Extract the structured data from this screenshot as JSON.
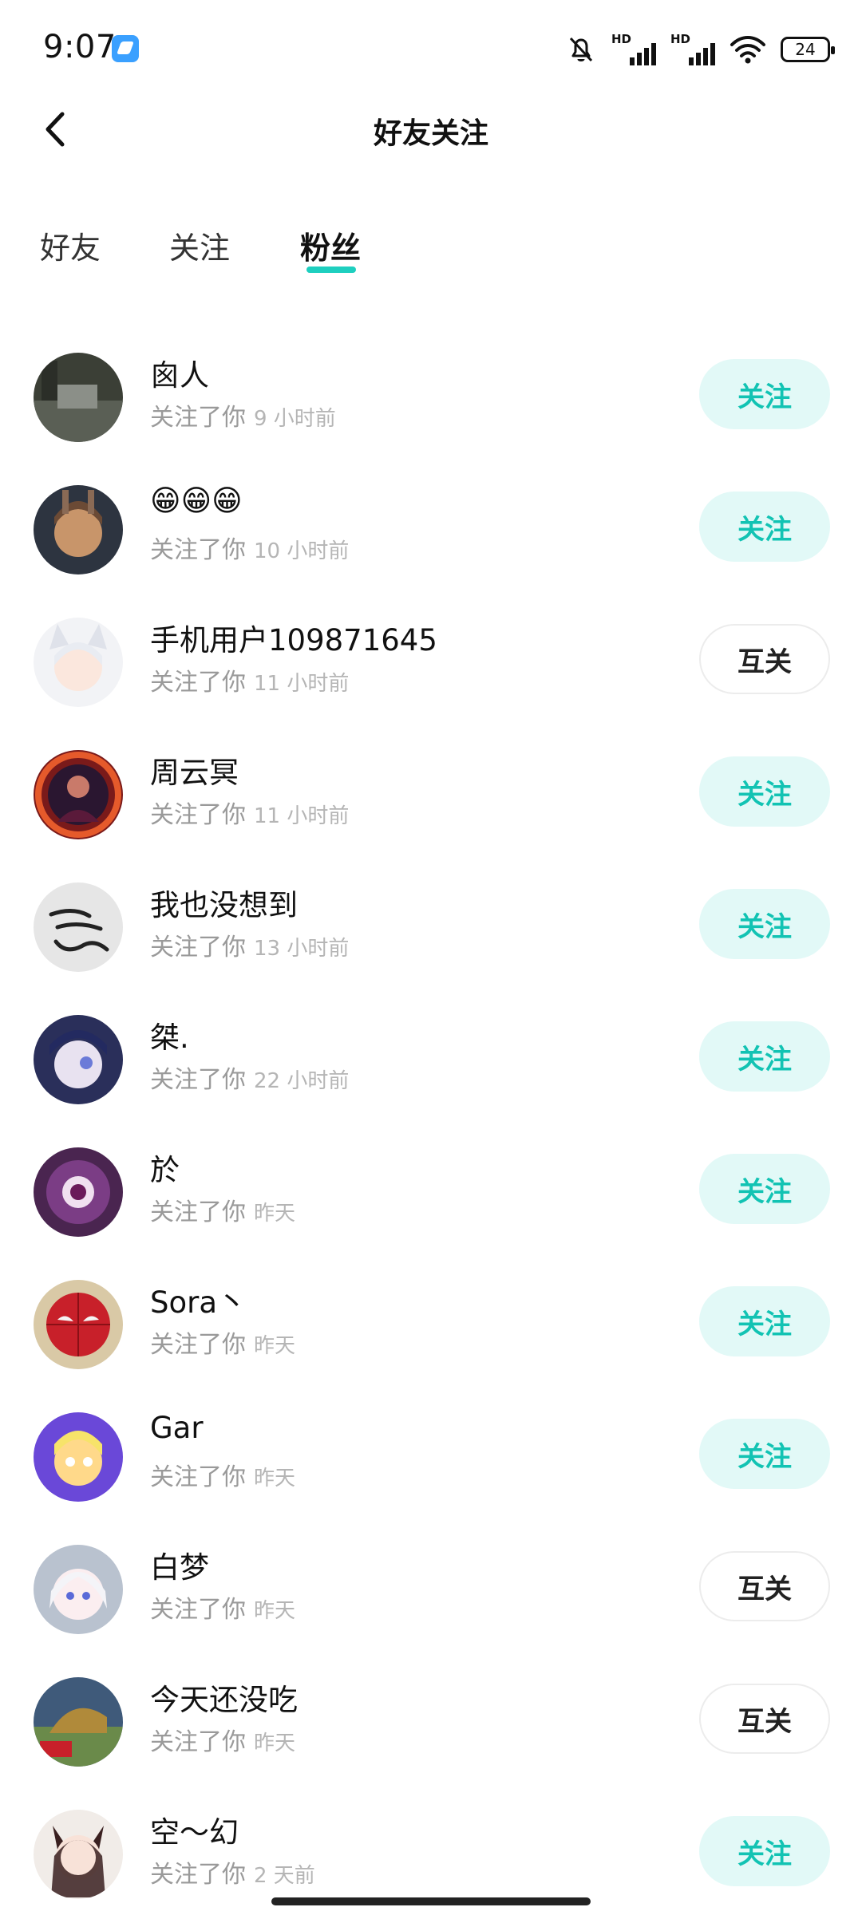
{
  "status_bar": {
    "time": "9:07",
    "battery": "24",
    "icons": [
      "app-badge-icon",
      "bell-muted-icon",
      "hd-signal-icon",
      "hd-signal-icon",
      "wifi-icon",
      "battery-icon"
    ]
  },
  "header": {
    "title": "好友关注",
    "back_icon": "chevron-left-icon"
  },
  "tabs": [
    {
      "label": "好友",
      "active": false
    },
    {
      "label": "关注",
      "active": false
    },
    {
      "label": "粉丝",
      "active": true
    }
  ],
  "colors": {
    "accent": "#1ecfbf",
    "follow_bg": "#e2f9f7",
    "follow_text": "#12c3b3"
  },
  "followers": [
    {
      "name": "囪人",
      "subtitle": "关注了你",
      "time": "9 小时前",
      "button": "关注"
    },
    {
      "name": "😁😁😁",
      "subtitle": "关注了你",
      "time": "10 小时前",
      "button": "关注"
    },
    {
      "name": "手机用户109871645",
      "subtitle": "关注了你",
      "time": "11 小时前",
      "button": "互关"
    },
    {
      "name": "周云冥",
      "subtitle": "关注了你",
      "time": "11 小时前",
      "button": "关注"
    },
    {
      "name": "我也没想到",
      "subtitle": "关注了你",
      "time": "13 小时前",
      "button": "关注"
    },
    {
      "name": "桀.",
      "subtitle": "关注了你",
      "time": "22 小时前",
      "button": "关注"
    },
    {
      "name": "於",
      "subtitle": "关注了你",
      "time": "昨天",
      "button": "关注"
    },
    {
      "name": "Sora丶",
      "subtitle": "关注了你",
      "time": "昨天",
      "button": "关注"
    },
    {
      "name": "Gar",
      "subtitle": "关注了你",
      "time": "昨天",
      "button": "关注"
    },
    {
      "name": "白梦",
      "subtitle": "关注了你",
      "time": "昨天",
      "button": "互关"
    },
    {
      "name": "今天还没吃",
      "subtitle": "关注了你",
      "time": "昨天",
      "button": "互关"
    },
    {
      "name": "空～幻",
      "subtitle": "关注了你",
      "time": "2 天前",
      "button": "关注"
    }
  ]
}
